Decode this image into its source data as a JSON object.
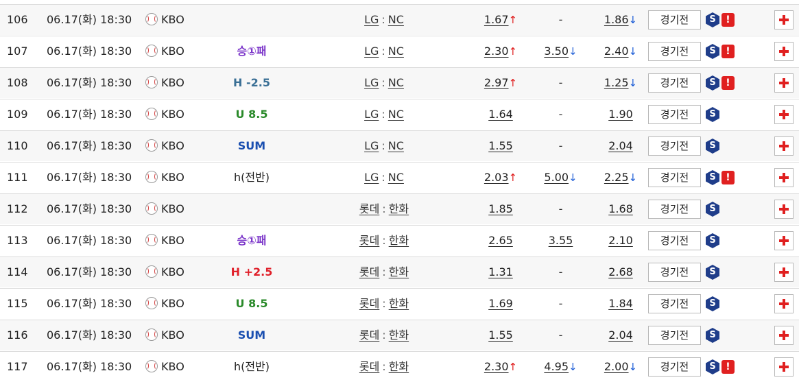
{
  "colors": {
    "win_type": "#7b35c9",
    "handicap_minus": "#3a6f95",
    "handicap_plus": "#e0202a",
    "under_over": "#2a8a2a",
    "sum": "#1a4fb0",
    "arrow_up": "#e02020",
    "arrow_down": "#1a5bd6"
  },
  "labels": {
    "prev_button": "경기전",
    "team_separator": ":",
    "dash": "-",
    "s_icon": "S",
    "warn_icon": "!"
  },
  "rows": [
    {
      "no": "106",
      "time": "06.17(화) 18:30",
      "league": "KBO",
      "type": "",
      "type_style": "plain",
      "home": "LG",
      "away": "NC",
      "win": "1.67",
      "win_arrow": "↑",
      "draw": "-",
      "draw_arrow": "",
      "lose": "1.86",
      "lose_arrow": "↓",
      "warn": true
    },
    {
      "no": "107",
      "time": "06.17(화) 18:30",
      "league": "KBO",
      "type": "승①패",
      "type_style": "win",
      "home": "LG",
      "away": "NC",
      "win": "2.30",
      "win_arrow": "↑",
      "draw": "3.50",
      "draw_arrow": "↓",
      "lose": "2.40",
      "lose_arrow": "↓",
      "warn": true
    },
    {
      "no": "108",
      "time": "06.17(화) 18:30",
      "league": "KBO",
      "type": "H -2.5",
      "type_style": "hminus",
      "home": "LG",
      "away": "NC",
      "win": "2.97",
      "win_arrow": "↑",
      "draw": "-",
      "draw_arrow": "",
      "lose": "1.25",
      "lose_arrow": "↓",
      "warn": true
    },
    {
      "no": "109",
      "time": "06.17(화) 18:30",
      "league": "KBO",
      "type": "U 8.5",
      "type_style": "uo",
      "home": "LG",
      "away": "NC",
      "win": "1.64",
      "win_arrow": "",
      "draw": "-",
      "draw_arrow": "",
      "lose": "1.90",
      "lose_arrow": "",
      "warn": false
    },
    {
      "no": "110",
      "time": "06.17(화) 18:30",
      "league": "KBO",
      "type": "SUM",
      "type_style": "sum",
      "home": "LG",
      "away": "NC",
      "win": "1.55",
      "win_arrow": "",
      "draw": "-",
      "draw_arrow": "",
      "lose": "2.04",
      "lose_arrow": "",
      "warn": false
    },
    {
      "no": "111",
      "time": "06.17(화) 18:30",
      "league": "KBO",
      "type": "h(전반)",
      "type_style": "plain",
      "home": "LG",
      "away": "NC",
      "win": "2.03",
      "win_arrow": "↑",
      "draw": "5.00",
      "draw_arrow": "↓",
      "lose": "2.25",
      "lose_arrow": "↓",
      "warn": true
    },
    {
      "no": "112",
      "time": "06.17(화) 18:30",
      "league": "KBO",
      "type": "",
      "type_style": "plain",
      "home": "롯데",
      "away": "한화",
      "win": "1.85",
      "win_arrow": "",
      "draw": "-",
      "draw_arrow": "",
      "lose": "1.68",
      "lose_arrow": "",
      "warn": false
    },
    {
      "no": "113",
      "time": "06.17(화) 18:30",
      "league": "KBO",
      "type": "승①패",
      "type_style": "win",
      "home": "롯데",
      "away": "한화",
      "win": "2.65",
      "win_arrow": "",
      "draw": "3.55",
      "draw_arrow": "",
      "lose": "2.10",
      "lose_arrow": "",
      "warn": false
    },
    {
      "no": "114",
      "time": "06.17(화) 18:30",
      "league": "KBO",
      "type": "H +2.5",
      "type_style": "hplus",
      "home": "롯데",
      "away": "한화",
      "win": "1.31",
      "win_arrow": "",
      "draw": "-",
      "draw_arrow": "",
      "lose": "2.68",
      "lose_arrow": "",
      "warn": false
    },
    {
      "no": "115",
      "time": "06.17(화) 18:30",
      "league": "KBO",
      "type": "U 8.5",
      "type_style": "uo",
      "home": "롯데",
      "away": "한화",
      "win": "1.69",
      "win_arrow": "",
      "draw": "-",
      "draw_arrow": "",
      "lose": "1.84",
      "lose_arrow": "",
      "warn": false
    },
    {
      "no": "116",
      "time": "06.17(화) 18:30",
      "league": "KBO",
      "type": "SUM",
      "type_style": "sum",
      "home": "롯데",
      "away": "한화",
      "win": "1.55",
      "win_arrow": "",
      "draw": "-",
      "draw_arrow": "",
      "lose": "2.04",
      "lose_arrow": "",
      "warn": false
    },
    {
      "no": "117",
      "time": "06.17(화) 18:30",
      "league": "KBO",
      "type": "h(전반)",
      "type_style": "plain",
      "home": "롯데",
      "away": "한화",
      "win": "2.30",
      "win_arrow": "↑",
      "draw": "4.95",
      "draw_arrow": "↓",
      "lose": "2.00",
      "lose_arrow": "↓",
      "warn": true
    }
  ]
}
